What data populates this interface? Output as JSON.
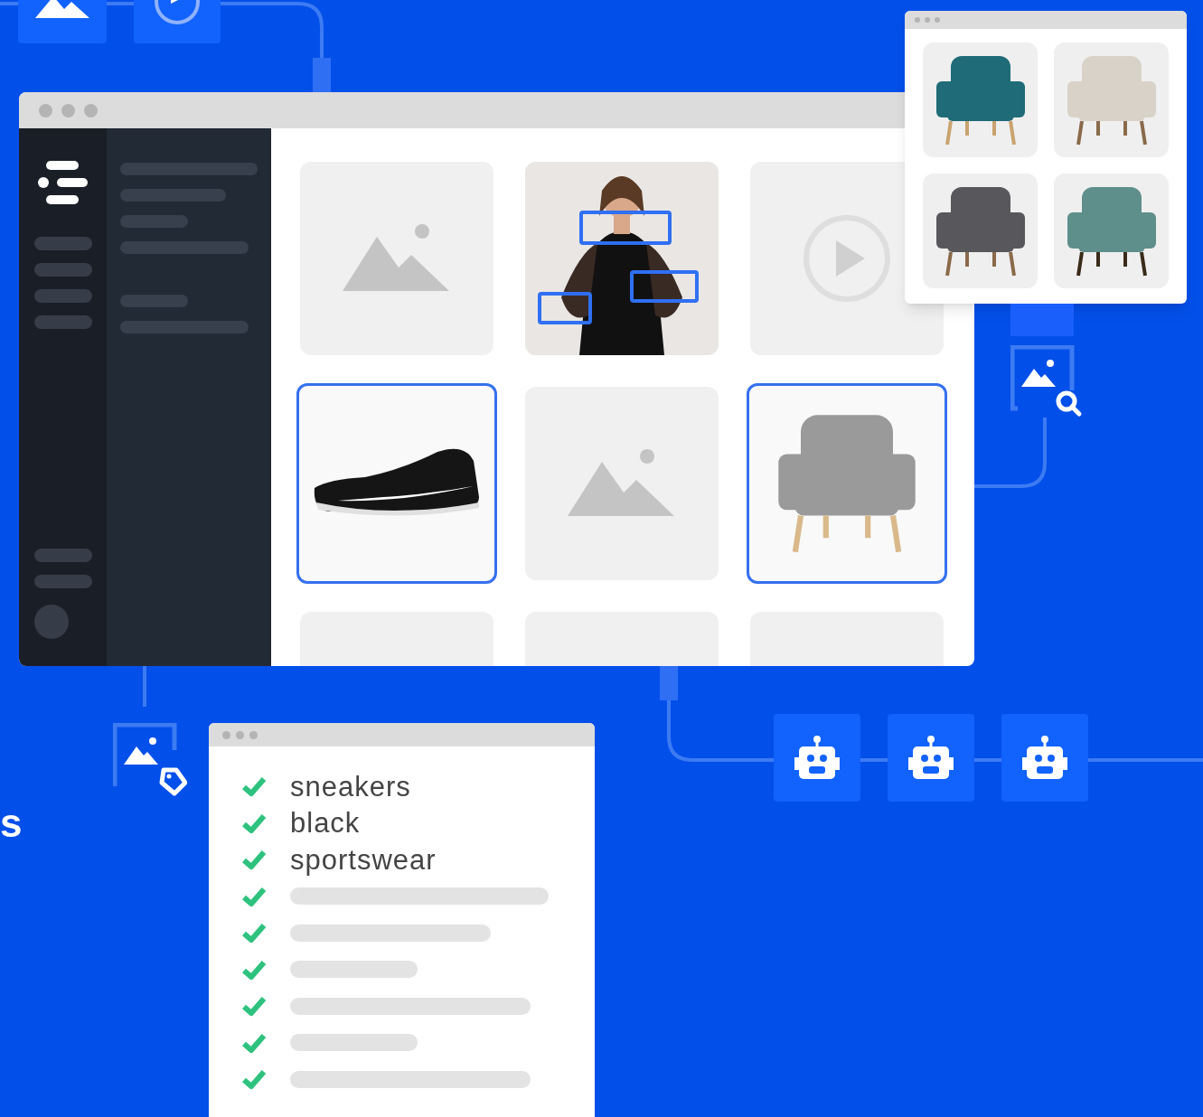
{
  "heading_fragment": "s",
  "media_grid": [
    {
      "kind": "image",
      "selected": false
    },
    {
      "kind": "photo",
      "selected": false
    },
    {
      "kind": "video",
      "selected": false
    },
    {
      "kind": "photo",
      "selected": true
    },
    {
      "kind": "image",
      "selected": false
    },
    {
      "kind": "photo",
      "selected": true
    },
    {
      "kind": "empty",
      "selected": false
    },
    {
      "kind": "empty",
      "selected": false
    },
    {
      "kind": "empty",
      "selected": false
    }
  ],
  "similar_results": [
    {
      "kind": "photo"
    },
    {
      "kind": "photo"
    },
    {
      "kind": "photo"
    },
    {
      "kind": "photo"
    }
  ],
  "tags": [
    {
      "kind": "text",
      "label": "sneakers",
      "checked": true
    },
    {
      "kind": "text",
      "label": "black",
      "checked": true
    },
    {
      "kind": "text",
      "label": "sportswear",
      "checked": true
    },
    {
      "kind": "skeleton",
      "checked": true
    },
    {
      "kind": "skeleton",
      "checked": true
    },
    {
      "kind": "skeleton",
      "checked": true
    },
    {
      "kind": "skeleton",
      "checked": true
    },
    {
      "kind": "skeleton",
      "checked": true
    },
    {
      "kind": "skeleton",
      "checked": true
    }
  ]
}
